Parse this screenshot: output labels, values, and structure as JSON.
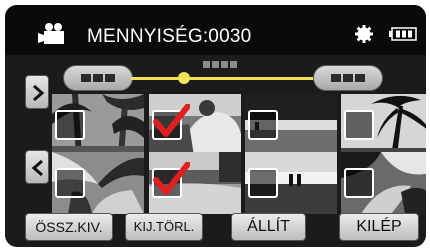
{
  "header": {
    "title": "MENNYISÉG:0030",
    "left_icon": "movie-camera-icon",
    "right_icons": [
      "gear-icon",
      "battery-icon"
    ]
  },
  "nav": {
    "next_icon": "chevron-right-icon",
    "prev_icon": "chevron-left-icon"
  },
  "seek_bar": {
    "position_fraction": 0.3
  },
  "thumbnails": [
    {
      "scene": "palm-trees",
      "checked": false
    },
    {
      "scene": "people-on-beach",
      "checked": true
    },
    {
      "scene": "shoreline",
      "checked": false
    },
    {
      "scene": "palm-trees-silhouette",
      "checked": false
    },
    {
      "scene": "tropical-plants",
      "checked": false
    },
    {
      "scene": "beach-sea",
      "checked": true
    },
    {
      "scene": "sunset-couple",
      "checked": false
    },
    {
      "scene": "palm-leaves",
      "checked": false
    }
  ],
  "softkeys": {
    "select_all": "ÖSSZ.KIV.",
    "clear_selection": "KIJ.TÖRL.",
    "set": "ÁLLÍT",
    "exit": "KILÉP"
  },
  "colors": {
    "background": "#1b1b1b",
    "seek_accent": "#f1e25a",
    "check": "#e02020"
  }
}
